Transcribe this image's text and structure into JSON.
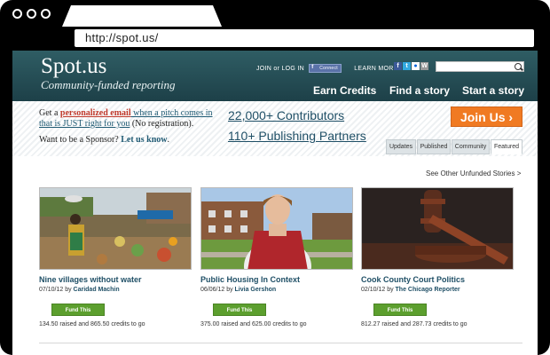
{
  "browser": {
    "url": "http://spot.us/"
  },
  "site": {
    "logo": "Spot.us",
    "tagline": "Community-funded reporting"
  },
  "toplinks": {
    "join_login": "JOIN or LOG IN",
    "connect": "Connect",
    "learn_more": "LEARN MORE"
  },
  "nav": {
    "earn": "Earn Credits",
    "find": "Find a story",
    "start": "Start a story"
  },
  "promo": {
    "get_a": "Get a ",
    "personalized": "personalized email",
    "when": " when a pitch comes in that is JUST right for you",
    "noreg": " (No registration).",
    "sponsor_q": "Want to be a Sponsor? ",
    "let_us_know": "Let us know",
    "period": "."
  },
  "stats": {
    "contributors": "22,000+ Contributors",
    "partners": "110+ Publishing Partners"
  },
  "join_button": "Join Us ›",
  "tabs": [
    "Updates",
    "Published",
    "Community",
    "Featured"
  ],
  "see_other": "See Other Unfunded Stories >",
  "stories": [
    {
      "title": "Nine villages without water",
      "date": "07/10/12 by ",
      "author": "Caridad Machin",
      "fund": "Fund This",
      "credits": "134.50 raised and 865.50 credits to go"
    },
    {
      "title": "Public Housing In Context",
      "date": "06/06/12 by ",
      "author": "Livia Gershon",
      "fund": "Fund This",
      "credits": "375.00 raised and 625.00 credits to go"
    },
    {
      "title": "Cook County Court Politics",
      "date": "02/10/12 by ",
      "author": "The Chicago Reporter",
      "fund": "Fund This",
      "credits": "812.27 raised and 287.73 credits to go"
    }
  ],
  "colors": {
    "header": "#1d4048",
    "accent_orange": "#f07a22",
    "fund_green": "#5c9f2e",
    "link_blue": "#1f4f66"
  }
}
